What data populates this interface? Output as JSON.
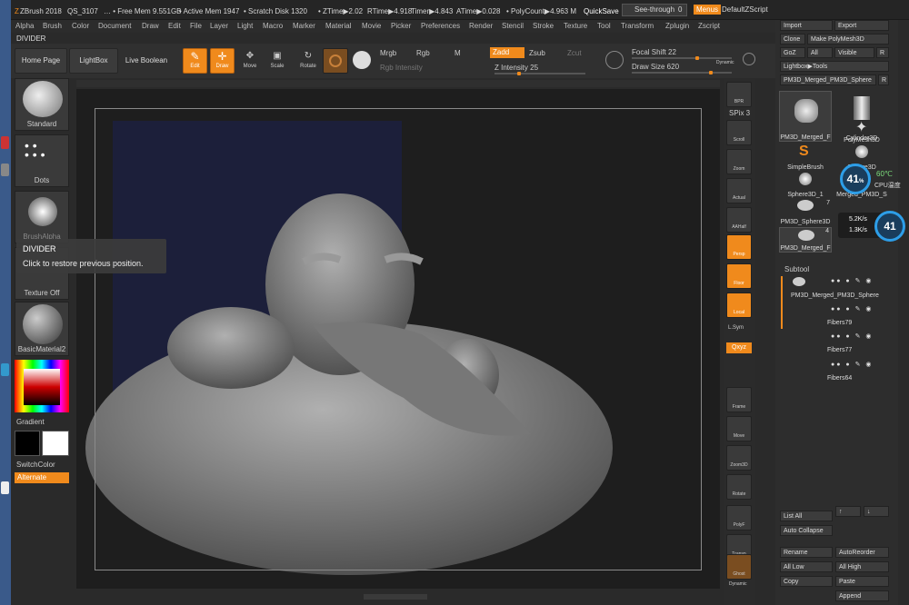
{
  "app": {
    "name": "ZBrush 2018",
    "file": "QS_3107"
  },
  "titlebar": {
    "free_mem": "… • Free Mem 9.551GB",
    "active_mem": "• Active Mem 1947",
    "scratch": "• Scratch Disk 1320",
    "ztime": "• ZTime▶2.02",
    "rtime": "RTime▶4.918",
    "timer": "Timer▶4.843",
    "atime": "ATime▶0.028",
    "polycount": "• PolyCount▶4.963 M",
    "quicksave": "QuickSave",
    "seethrough_label": "See-through",
    "seethrough_value": "0",
    "menus": "Menus",
    "script": "DefaultZScript"
  },
  "menu": [
    "Alpha",
    "Brush",
    "Color",
    "Document",
    "Draw",
    "Edit",
    "File",
    "Layer",
    "Light",
    "Macro",
    "Marker",
    "Material",
    "Movie",
    "Picker",
    "Preferences",
    "Render",
    "Stencil",
    "Stroke",
    "Texture",
    "Tool",
    "Transform",
    "Zplugin",
    "Zscript"
  ],
  "divider": "DIVIDER",
  "topbar": {
    "home": "Home Page",
    "lightbox": "LightBox",
    "liveboolean": "Live Boolean",
    "edit": "Edit",
    "draw": "Draw",
    "move": "Move",
    "scale": "Scale",
    "rotate": "Rotate",
    "mrgb": "Mrgb",
    "rgb": "Rgb",
    "m": "M",
    "zadd": "Zadd",
    "zsub": "Zsub",
    "zcut": "Zcut",
    "rgb_intensity": "Rgb Intensity",
    "z_intensity": "Z Intensity 25",
    "focal_shift": "Focal Shift 22",
    "draw_size": "Draw Size 620",
    "dynamic": "Dynamic"
  },
  "leftpanel": {
    "standard": "Standard",
    "dots": "Dots",
    "alpha": "BrushAlpha",
    "texture": "Texture Off",
    "material": "BasicMaterial2",
    "gradient": "Gradient",
    "switchcolor": "SwitchColor",
    "alternate": "Alternate"
  },
  "tooltip": {
    "title": "DIVIDER",
    "text": "Click to restore previous position."
  },
  "righttools": [
    "BPR",
    "SPix 3",
    "Scroll",
    "Zoom",
    "Actual",
    "AAHalf",
    "Persp",
    "Floor",
    "Local",
    "L.Sym",
    "Qxyz",
    "Frame",
    "Move",
    "Zoom3D",
    "Rotate",
    "PolyF",
    "Transp",
    "Ghost",
    "Dynamic"
  ],
  "toolpanel": {
    "import": "Import",
    "export": "Export",
    "clone": "Clone",
    "makepoly": "Make PolyMesh3D",
    "goz": "GoZ",
    "all": "All",
    "visible": "Visible",
    "r": "R",
    "lightbox_tools": "Lightbox▶Tools",
    "current": "PM3D_Merged_PM3D_Sphere",
    "r2": "R",
    "tools": [
      {
        "name": "PM3D_Merged_F",
        "badge": "4"
      },
      {
        "name": "Cylinder3D",
        "badge": ""
      },
      {
        "name": "",
        "badge": ""
      },
      {
        "name": "PolyMesh3D",
        "badge": ""
      },
      {
        "name": "SimpleBrush",
        "badge": ""
      },
      {
        "name": "Sphere3D",
        "badge": ""
      },
      {
        "name": "Sphere3D_1",
        "badge": ""
      },
      {
        "name": "Merged_PM3D_S",
        "badge": ""
      },
      {
        "name": "PM3D_Sphere3D",
        "badge": "7"
      },
      {
        "name": "",
        "badge": ""
      },
      {
        "name": "PM3D_Merged_F",
        "badge": "4"
      }
    ]
  },
  "monitor": {
    "cpu_pct": "41",
    "cpu_unit": "%",
    "temp": "60℃",
    "cpu_label": "CPU温度",
    "up": "5.2K/s",
    "down": "1.3K/s",
    "net_pct": "41"
  },
  "subtool": {
    "title": "Subtool",
    "items": [
      "PM3D_Merged_PM3D_Sphere",
      "Fibers79",
      "Fibers77",
      "Fibers64"
    ],
    "listall": "List All",
    "autocollapse": "Auto Collapse",
    "rename": "Rename",
    "autoreorder": "AutoReorder",
    "alllow": "All Low",
    "allhigh": "All High",
    "copy": "Copy",
    "paste": "Paste",
    "append": "Append"
  }
}
